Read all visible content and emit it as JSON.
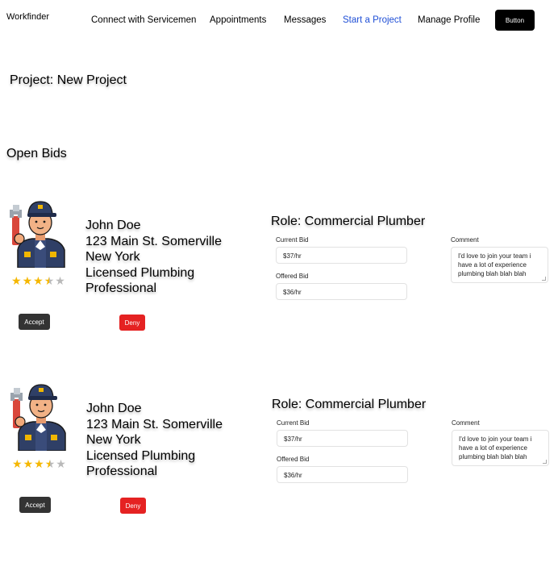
{
  "header": {
    "brand": "Workfinder",
    "nav": [
      "Connect with Servicemen",
      "Appointments",
      "Messages",
      "Start a Project",
      "Manage Profile"
    ],
    "active_nav": "Start a Project",
    "button_label": "Button"
  },
  "page": {
    "project_title": "Project: New Project",
    "section_title": "Open Bids"
  },
  "bids": [
    {
      "avatar_icon": "plumber-avatar-icon",
      "rating": 3.5,
      "rating_max": 5,
      "name": "John Doe",
      "address": "123 Main St. Somerville",
      "state": "New York",
      "license_line1": "Licensed Plumbing",
      "license_line2": "Professional",
      "role": "Role: Commercial Plumber",
      "current_bid_label": "Current Bid",
      "current_bid": "$37/hr",
      "offered_bid_label": "Offered Bid",
      "offered_bid": "$36/hr",
      "comment_label": "Comment",
      "comment": "I'd love to join your team i have a lot of experience plumbing blah blah blah",
      "accept_label": "Accept",
      "deny_label": "Deny"
    },
    {
      "avatar_icon": "plumber-avatar-icon",
      "rating": 3.5,
      "rating_max": 5,
      "name": "John Doe",
      "address": "123 Main St. Somerville",
      "state": "New York",
      "license_line1": "Licensed Plumbing",
      "license_line2": "Professional",
      "role": "Role: Commercial Plumber",
      "current_bid_label": "Current Bid",
      "current_bid": "$37/hr",
      "offered_bid_label": "Offered Bid",
      "offered_bid": "$36/hr",
      "comment_label": "Comment",
      "comment": "I'd love to join your team i have a lot of experience plumbing blah blah blah",
      "accept_label": "Accept",
      "deny_label": "Deny"
    }
  ],
  "colors": {
    "accent_nav": "#1f4fd6",
    "deny": "#e52222",
    "accept": "#333333",
    "star": "#f5b700"
  }
}
